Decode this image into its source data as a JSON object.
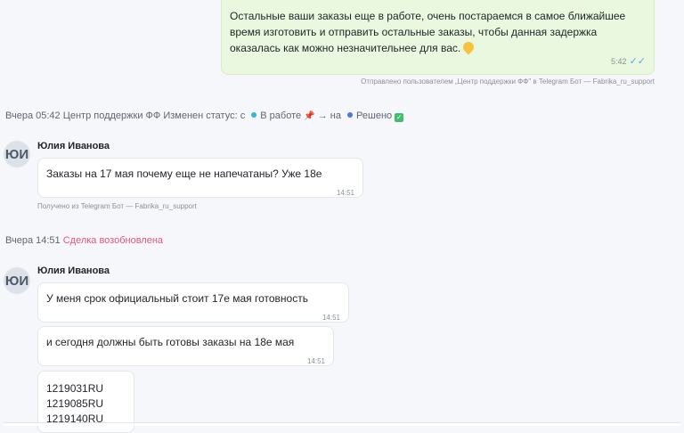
{
  "outgoing": {
    "text": "Остальные ваши заказы еще в работе, очень постараемся в самое ближайшее время изготовить и отправить остальные заказы, чтобы данная задержка оказалась как можно незначительнее для вас.",
    "time": "5:42",
    "caption": "Отправлено пользователем „Центр поддержки ФФ\" в Telegram Бот — Fabrika_ru_support"
  },
  "status_event": {
    "time": "Вчера 05:42",
    "actor": "Центр поддержки ФФ",
    "action": "Изменен статус: с",
    "from": "В работе",
    "arrow": "→",
    "to_prefix": "на",
    "to": "Решено",
    "colors": {
      "from_dot": "#2fb9d6",
      "to_dot": "#4a78e0",
      "pin": "#e3455f",
      "check": "#3fbf6b"
    }
  },
  "message_group_1": {
    "avatar": "ЮИ",
    "sender": "Юлия Иванова",
    "messages": [
      {
        "text": "Заказы на 17 мая  почему еще не напечатаны?  Уже 18е",
        "time": "14:51"
      }
    ],
    "caption": "Получено из Telegram Бот — Fabrika_ru_support"
  },
  "deal_event": {
    "time": "Вчера 14:51",
    "text": "Сделка возобновлена",
    "color": "#e8547a"
  },
  "message_group_2": {
    "avatar": "ЮИ",
    "sender": "Юлия Иванова",
    "messages": [
      {
        "text": "У меня срок официальный стоит 17е мая готовность",
        "time": "14:51"
      },
      {
        "text": "и сегодня должны быть готовы заказы на 18е мая",
        "time": "14:51"
      },
      {
        "lines": [
          "1219031RU",
          "1219085RU",
          "1219140RU"
        ]
      }
    ]
  }
}
